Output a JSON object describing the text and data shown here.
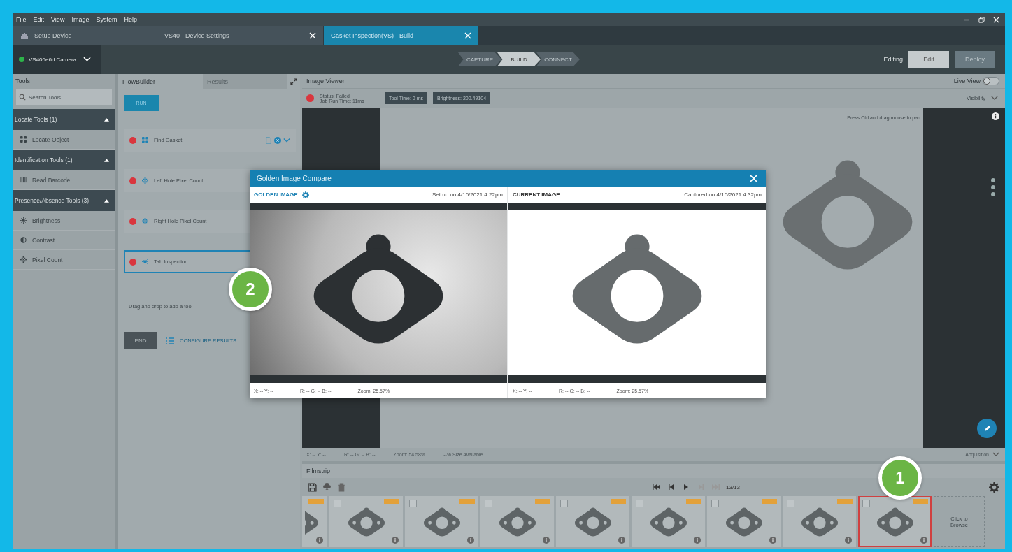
{
  "menu": [
    "File",
    "Edit",
    "View",
    "Image",
    "System",
    "Help"
  ],
  "doc_tabs": [
    {
      "label": "Setup Device",
      "kind": "home",
      "selected": false
    },
    {
      "label": "VS40 - Device Settings",
      "kind": "doc",
      "selected": false
    },
    {
      "label": "Gasket Inspection(VS) - Build",
      "kind": "doc",
      "selected": true
    }
  ],
  "device": {
    "name": "VS406e6d Camera",
    "connected": true
  },
  "steps": [
    {
      "label": "CAPTURE",
      "selected": false
    },
    {
      "label": "BUILD",
      "selected": true
    },
    {
      "label": "CONNECT",
      "selected": false
    }
  ],
  "mode": {
    "label": "Editing",
    "buttons": [
      {
        "label": "Edit",
        "selected": true
      },
      {
        "label": "Deploy",
        "selected": false
      }
    ]
  },
  "tools": {
    "title": "Tools",
    "search": {
      "placeholder": "Search Tools"
    },
    "groups": [
      {
        "label": "Locate Tools (1)",
        "expanded": true,
        "items": [
          {
            "label": "Locate Object",
            "kind": "locate"
          }
        ]
      },
      {
        "label": "Identification Tools (1)",
        "expanded": true,
        "items": [
          {
            "label": "Read Barcode",
            "kind": "barcode"
          }
        ]
      },
      {
        "label": "Presence/Absence Tools (3)",
        "expanded": true,
        "items": [
          {
            "label": "Brightness",
            "kind": "brightness"
          },
          {
            "label": "Contrast",
            "kind": "contrast"
          },
          {
            "label": "Pixel Count",
            "kind": "pixel"
          }
        ]
      }
    ]
  },
  "flow": {
    "tabs": [
      {
        "label": "FlowBuilder",
        "selected": true
      },
      {
        "label": "Results",
        "selected": false
      }
    ],
    "start": "RUN",
    "items": [
      {
        "label": "Find Gasket",
        "kind": "locate",
        "passed": false,
        "selected": false,
        "actions": true
      },
      {
        "label": "Left Hole Pixel Count",
        "kind": "pixel",
        "passed": false,
        "selected": false,
        "actions": false
      },
      {
        "label": "Right Hole Pixel Count",
        "kind": "pixel",
        "passed": false,
        "selected": false,
        "actions": false
      },
      {
        "label": "Tab Inspection",
        "kind": "brightness",
        "passed": false,
        "selected": true,
        "actions": false
      }
    ],
    "drop_hint": "Drag and drop to add a tool",
    "end": "END",
    "configure": "CONFIGURE RESULTS"
  },
  "viewer": {
    "title": "Image Viewer",
    "live_view": {
      "label": "Live View",
      "on": false
    },
    "status": {
      "label": "Status:",
      "value": "Failed",
      "passed": false
    },
    "run_time": {
      "label": "Job Run Time:",
      "value": "11ms"
    },
    "chips": [
      "Tool Time: 0 ms",
      "Brightness: 200.49104"
    ],
    "visibility": "Visibility",
    "hint": "Press Ctrl and drag mouse to pan",
    "info": [
      "X: -- Y: --",
      "R: -- G: -- B: --",
      "Zoom: 54.58%",
      "--% Size Available"
    ],
    "acquisition": "Acquisition"
  },
  "filmstrip": {
    "title": "Filmstrip",
    "counter": "13/13",
    "browse": "Click to Browse",
    "frames": [
      {
        "selected": false,
        "partial": true
      },
      {
        "selected": false,
        "partial": false
      },
      {
        "selected": false,
        "partial": false
      },
      {
        "selected": false,
        "partial": false
      },
      {
        "selected": false,
        "partial": false
      },
      {
        "selected": false,
        "partial": false
      },
      {
        "selected": false,
        "partial": false
      },
      {
        "selected": false,
        "partial": false
      },
      {
        "selected": true,
        "partial": false
      }
    ]
  },
  "dialog": {
    "title": "Golden Image Compare",
    "panes": [
      {
        "label": "GOLDEN IMAGE",
        "kind": "golden",
        "meta": "Set up on 4/16/2021 4:22pm",
        "info": [
          "X: -- Y: --",
          "R: -- G: -- B: --",
          "Zoom: 25.57%"
        ]
      },
      {
        "label": "CURRENT IMAGE",
        "kind": "current",
        "meta": "Captured on 4/16/2021 4:32pm",
        "info": [
          "X: -- Y: --",
          "R: -- G: -- B: --",
          "Zoom: 25.57%"
        ]
      }
    ]
  },
  "callouts": [
    "1",
    "2"
  ]
}
